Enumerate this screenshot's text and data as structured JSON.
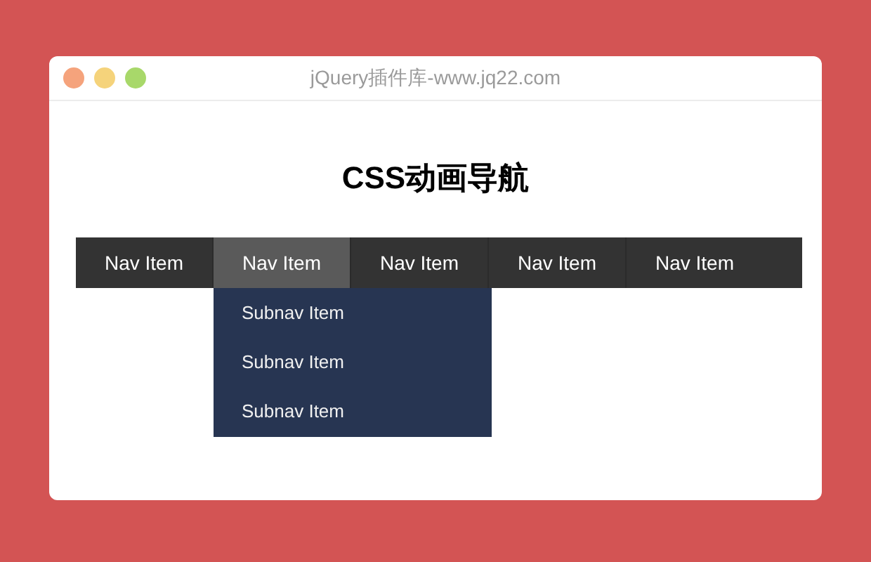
{
  "window": {
    "title": "jQuery插件库-www.jq22.com"
  },
  "heading": "CSS动画导航",
  "nav": {
    "items": [
      {
        "label": "Nav Item",
        "selected": false
      },
      {
        "label": "Nav Item",
        "selected": true,
        "expanded": true,
        "children": [
          {
            "label": "Subnav Item"
          },
          {
            "label": "Subnav Item"
          },
          {
            "label": "Subnav Item"
          }
        ]
      },
      {
        "label": "Nav Item",
        "selected": false
      },
      {
        "label": "Nav Item",
        "selected": false
      },
      {
        "label": "Nav Item",
        "selected": false
      }
    ]
  }
}
